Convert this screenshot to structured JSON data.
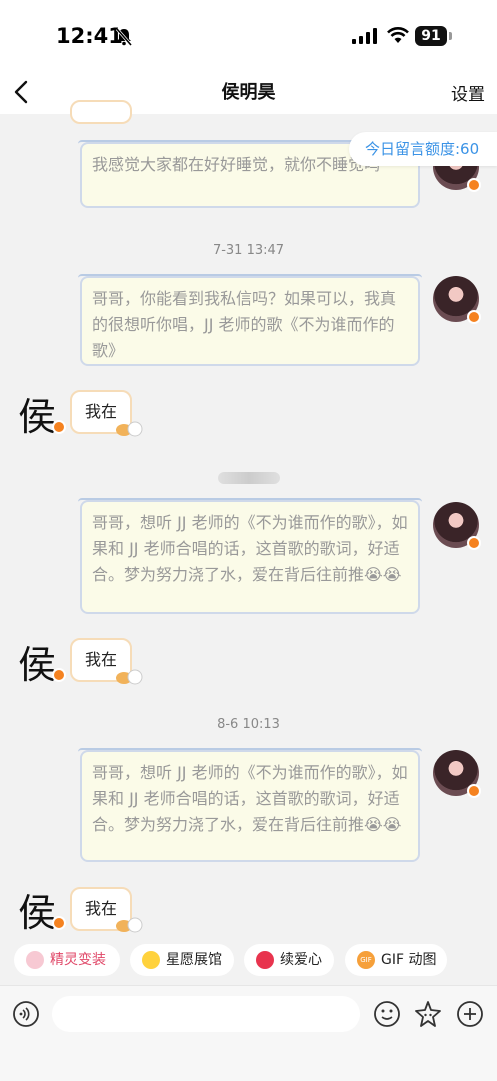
{
  "status": {
    "time": "12:41",
    "battery": "91"
  },
  "nav": {
    "title": "侯明昊",
    "settings": "设置"
  },
  "quota": "今日留言额度:60",
  "messages": {
    "m0": "我感觉大家都在好好睡觉，就你不睡觉呜",
    "t1": "7-31 13:47",
    "m1": "哥哥，你能看到我私信吗？如果可以，我真的很想听你唱，JJ 老师的歌《不为谁而作的歌》",
    "r1": "我在",
    "m2": "哥哥，想听 JJ 老师的《不为谁而作的歌》，如果和 JJ 老师合唱的话，这首歌的歌词，好适合。梦为努力浇了水，爱在背后往前推😭😭",
    "r2": "我在",
    "t2": "8-6 10:13",
    "m3": "哥哥，想听 JJ 老师的《不为谁而作的歌》，如果和 JJ 老师合唱的话，这首歌的歌词，好适合。梦为努力浇了水，爱在背后往前推😭😭",
    "r3": "我在"
  },
  "avatar_char": "侯",
  "chips": [
    "精灵变装",
    "星愿展馆",
    "续爱心",
    "GIF 动图"
  ],
  "chip_gif_tag": "GIF",
  "colors": {
    "accent_blue": "#3b93e6",
    "badge_orange": "#f58220",
    "chip_pink": "#e04868"
  }
}
